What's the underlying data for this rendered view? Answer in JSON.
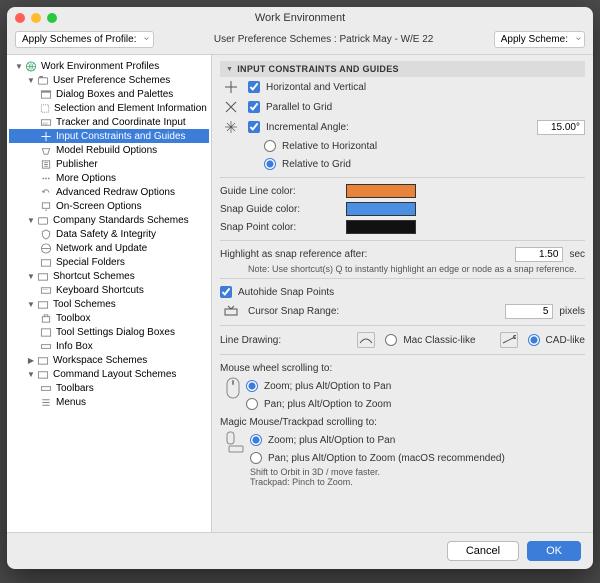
{
  "title": "Work Environment",
  "toolbar": {
    "apply_profile": "Apply Schemes of Profile:",
    "breadcrumb": "User Preference Schemes :  Patrick May - W/E 22",
    "apply_scheme": "Apply Scheme:"
  },
  "tree": {
    "root": "Work Environment Profiles",
    "user_pref": "User Preference Schemes",
    "items_user": [
      "Dialog Boxes and Palettes",
      "Selection and Element Information",
      "Tracker and Coordinate Input",
      "Input Constraints and Guides",
      "Model Rebuild Options",
      "Publisher",
      "More Options",
      "Advanced Redraw Options",
      "On-Screen Options"
    ],
    "company": "Company Standards Schemes",
    "items_company": [
      "Data Safety & Integrity",
      "Network and Update",
      "Special Folders"
    ],
    "shortcut": "Shortcut Schemes",
    "items_shortcut": [
      "Keyboard Shortcuts"
    ],
    "tool": "Tool Schemes",
    "items_tool": [
      "Toolbox",
      "Tool Settings Dialog Boxes",
      "Info Box"
    ],
    "workspace": "Workspace Schemes",
    "command": "Command Layout Schemes",
    "items_command": [
      "Toolbars",
      "Menus"
    ]
  },
  "panel": {
    "header": "INPUT CONSTRAINTS AND GUIDES",
    "horiz_vert": "Horizontal and Vertical",
    "parallel": "Parallel to Grid",
    "incr_angle": "Incremental Angle:",
    "incr_value": "15.00°",
    "rel_horiz": "Relative to Horizontal",
    "rel_grid": "Relative to Grid",
    "guide_color": "Guide Line color:",
    "snap_guide_color": "Snap Guide color:",
    "snap_point_color": "Snap Point color:",
    "highlight_after": "Highlight as snap reference after:",
    "highlight_value": "1.50",
    "sec": "sec",
    "note": "Note: Use shortcut(s) Q to instantly highlight an edge or node as a snap reference.",
    "autohide": "Autohide Snap Points",
    "cursor_range": "Cursor Snap Range:",
    "cursor_value": "5",
    "pixels": "pixels",
    "line_drawing": "Line Drawing:",
    "mac_classic": "Mac Classic-like",
    "cad_like": "CAD-like",
    "mouse_wheel": "Mouse wheel scrolling to:",
    "zoom_alt_pan": "Zoom; plus Alt/Option to Pan",
    "pan_alt_zoom": "Pan; plus Alt/Option to Zoom",
    "magic_mouse": "Magic Mouse/Trackpad scrolling to:",
    "pan_alt_zoom_rec": "Pan; plus Alt/Option to Zoom (macOS recommended)",
    "shift_orbit": "Shift to Orbit in 3D / move faster.",
    "trackpad_pinch": "Trackpad: Pinch to Zoom."
  },
  "footer": {
    "cancel": "Cancel",
    "ok": "OK"
  }
}
